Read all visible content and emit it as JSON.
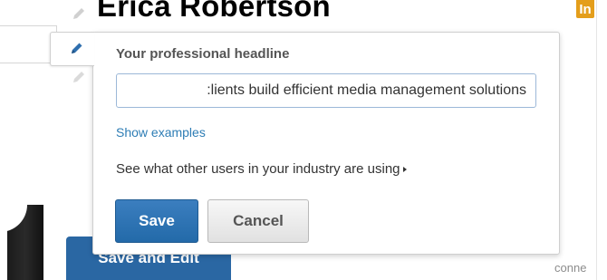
{
  "profile": {
    "name": "Erica Robertson",
    "badge": "In",
    "background_button_label": "Save and Edit",
    "connections_text": "conne"
  },
  "headline_editor": {
    "title": "Your professional headline",
    "input_value": ":lients build efficient media management solutions",
    "show_examples_label": "Show examples",
    "industry_link_label": "See what other users in your industry are using",
    "save_label": "Save",
    "cancel_label": "Cancel"
  },
  "icons": {
    "edit": "pencil-icon",
    "expand": "caret-right-icon"
  },
  "colors": {
    "link_blue": "#2e7db5",
    "primary_button": "#236aa9",
    "badge_orange": "#e49e1b"
  }
}
